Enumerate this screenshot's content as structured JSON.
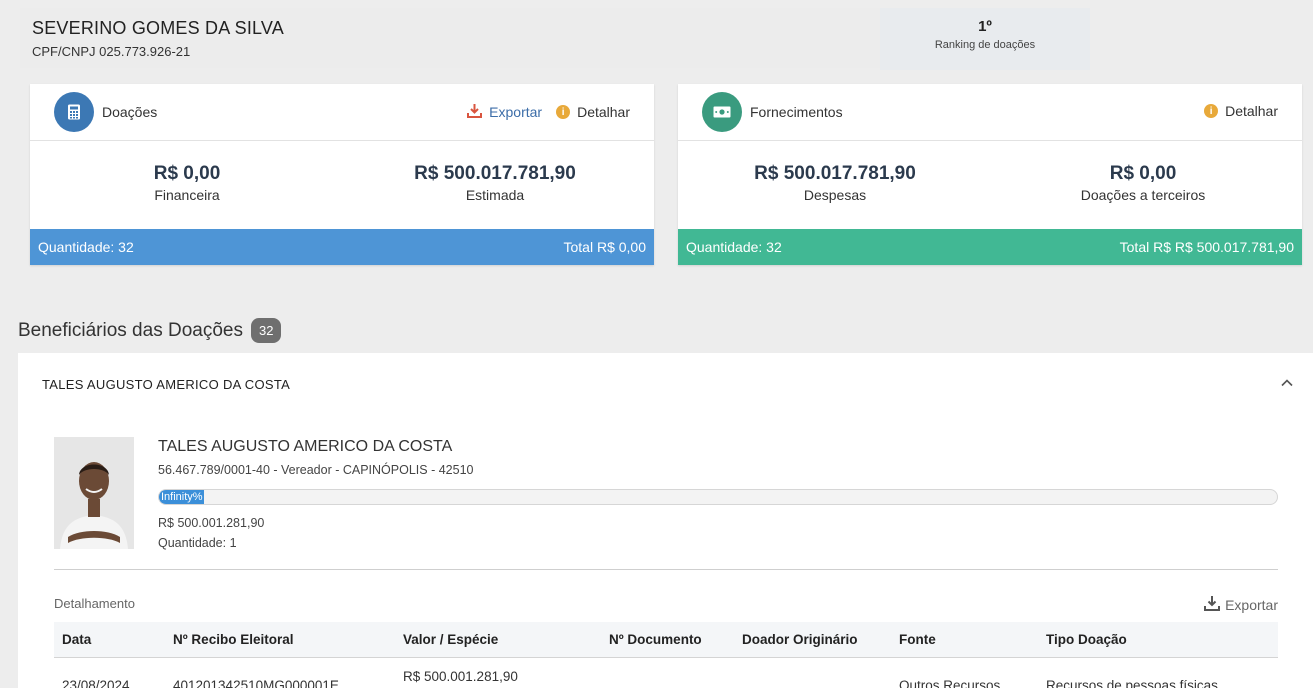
{
  "donor": {
    "name": "SEVERINO GOMES DA SILVA",
    "document": "CPF/CNPJ 025.773.926-21"
  },
  "ranking": {
    "position": "1º",
    "label": "Ranking de doações"
  },
  "donations_card": {
    "title": "Doações",
    "export_label": "Exportar",
    "detail_label": "Detalhar",
    "financial_value": "R$ 0,00",
    "financial_label": "Financeira",
    "estimated_value": "R$ 500.017.781,90",
    "estimated_label": "Estimada",
    "quantity": "Quantidade: 32",
    "total": "Total R$ 0,00",
    "color": "#4e95d6"
  },
  "supplies_card": {
    "title": "Fornecimentos",
    "detail_label": "Detalhar",
    "expenses_value": "R$ 500.017.781,90",
    "expenses_label": "Despesas",
    "third_party_value": "R$ 0,00",
    "third_party_label": "Doações a terceiros",
    "quantity": "Quantidade: 32",
    "total": "Total R$ R$ 500.017.781,90",
    "color": "#41b894"
  },
  "beneficiaries": {
    "title": "Beneficiários das Doações",
    "count": "32"
  },
  "beneficiary": {
    "header_name": "TALES AUGUSTO AMERICO DA COSTA",
    "name": "TALES AUGUSTO AMERICO DA COSTA",
    "info": "56.467.789/0001-40 - Vereador - CAPINÓPOLIS - 42510",
    "progress_label": "Infinity%",
    "progress_fraction": 0.04,
    "value": "R$ 500.001.281,90",
    "quantity": "Quantidade: 1"
  },
  "details": {
    "label": "Detalhamento",
    "export_label": "Exportar",
    "columns": [
      "Data",
      "Nº Recibo Eleitoral",
      "Valor / Espécie",
      "Nº Documento",
      "Doador Originário",
      "Fonte",
      "Tipo Doação"
    ],
    "rows": [
      {
        "date": "23/08/2024",
        "receipt": "401201342510MG000001E",
        "value": "R$ 500.001.281,90",
        "document": "",
        "origin_donor": "",
        "source": "Outros Recursos",
        "type": "Recursos de pessoas físicas"
      }
    ]
  }
}
